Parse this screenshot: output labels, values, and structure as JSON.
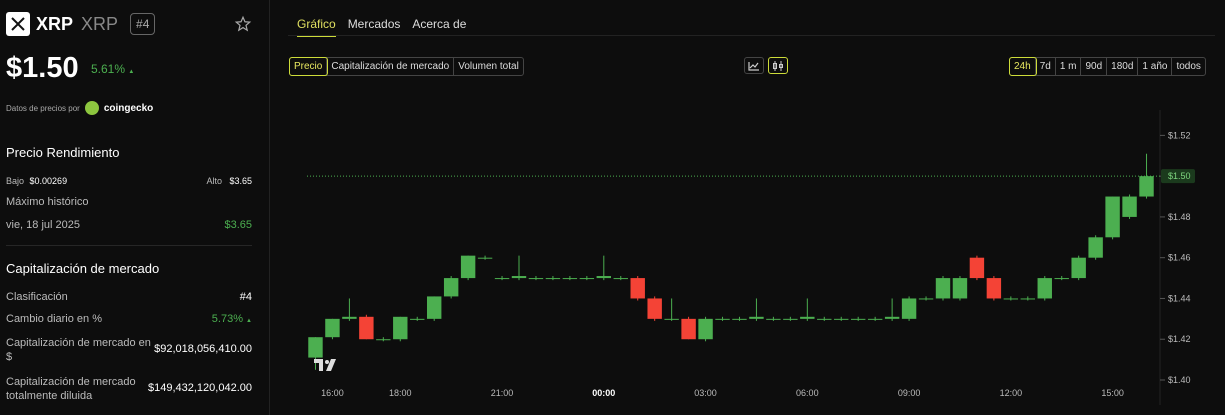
{
  "coin": {
    "symbol": "XRP",
    "name": "XRP",
    "rank": "#4",
    "price": "$1.50",
    "change": "5.61%",
    "change_arrow": "▲",
    "provider_prefix": "Datos de precios por",
    "provider": "coingecko"
  },
  "performance": {
    "title": "Precio Rendimiento",
    "low_label": "Bajo",
    "low_value": "$0.00269",
    "high_label": "Alto",
    "high_value": "$3.65",
    "ath_label": "Máximo histórico",
    "ath_date": "vie, 18 jul 2025",
    "ath_value": "$3.65"
  },
  "market": {
    "title": "Capitalización de mercado",
    "rank_label": "Clasificación",
    "rank_value": "#4",
    "daily_label": "Cambio diario en %",
    "daily_value": "5.73%",
    "daily_arrow": "▲",
    "cap_label": "Capitalización de mercado en $",
    "cap_value": "$92,018,056,410.00",
    "fdv_label": "Capitalización de mercado totalmente diluida",
    "fdv_value": "$149,432,120,042.00"
  },
  "tabs": [
    "Gráfico",
    "Mercados",
    "Acerca de"
  ],
  "metric_options": [
    "Precio",
    "Capitalización de mercado",
    "Volumen total"
  ],
  "chart_type_icons": [
    "line-chart-icon",
    "candlestick-icon"
  ],
  "ranges": [
    "24h",
    "7d",
    "1 m",
    "90d",
    "180d",
    "1 año",
    "todos"
  ],
  "colors": {
    "up": "#4caf50",
    "down": "#f44336",
    "accent": "#cddc39"
  },
  "chart_data": {
    "type": "candlestick",
    "x_tick_labels": [
      "16:00",
      "18:00",
      "21:00",
      "00:00",
      "03:00",
      "06:00",
      "09:00",
      "12:00",
      "15:00"
    ],
    "x_tick_index": [
      1,
      5,
      11,
      17,
      23,
      29,
      35,
      41,
      47
    ],
    "y_ticks": [
      1.4,
      1.42,
      1.44,
      1.46,
      1.48,
      1.5,
      1.52
    ],
    "y_tick_labels": [
      "$1.40",
      "$1.42",
      "$1.44",
      "$1.46",
      "$1.48",
      "$1.50",
      "$1.52"
    ],
    "ylim": [
      1.4,
      1.53
    ],
    "current_price": 1.5,
    "current_label": "$1.50",
    "candles": [
      {
        "o": 1.411,
        "h": 1.421,
        "l": 1.405,
        "c": 1.421
      },
      {
        "o": 1.421,
        "h": 1.43,
        "l": 1.42,
        "c": 1.43
      },
      {
        "o": 1.43,
        "h": 1.44,
        "l": 1.429,
        "c": 1.431
      },
      {
        "o": 1.431,
        "h": 1.432,
        "l": 1.42,
        "c": 1.42
      },
      {
        "o": 1.42,
        "h": 1.421,
        "l": 1.419,
        "c": 1.42
      },
      {
        "o": 1.42,
        "h": 1.431,
        "l": 1.419,
        "c": 1.431
      },
      {
        "o": 1.43,
        "h": 1.431,
        "l": 1.429,
        "c": 1.43
      },
      {
        "o": 1.43,
        "h": 1.441,
        "l": 1.429,
        "c": 1.441
      },
      {
        "o": 1.441,
        "h": 1.451,
        "l": 1.44,
        "c": 1.45
      },
      {
        "o": 1.45,
        "h": 1.461,
        "l": 1.449,
        "c": 1.461
      },
      {
        "o": 1.46,
        "h": 1.461,
        "l": 1.459,
        "c": 1.46
      },
      {
        "o": 1.45,
        "h": 1.451,
        "l": 1.449,
        "c": 1.45
      },
      {
        "o": 1.45,
        "h": 1.461,
        "l": 1.449,
        "c": 1.451
      },
      {
        "o": 1.45,
        "h": 1.451,
        "l": 1.449,
        "c": 1.45
      },
      {
        "o": 1.45,
        "h": 1.451,
        "l": 1.449,
        "c": 1.45
      },
      {
        "o": 1.45,
        "h": 1.451,
        "l": 1.449,
        "c": 1.45
      },
      {
        "o": 1.45,
        "h": 1.451,
        "l": 1.449,
        "c": 1.45
      },
      {
        "o": 1.45,
        "h": 1.461,
        "l": 1.449,
        "c": 1.451
      },
      {
        "o": 1.45,
        "h": 1.451,
        "l": 1.449,
        "c": 1.45
      },
      {
        "o": 1.45,
        "h": 1.451,
        "l": 1.439,
        "c": 1.44
      },
      {
        "o": 1.44,
        "h": 1.441,
        "l": 1.429,
        "c": 1.43
      },
      {
        "o": 1.43,
        "h": 1.44,
        "l": 1.429,
        "c": 1.43
      },
      {
        "o": 1.43,
        "h": 1.431,
        "l": 1.42,
        "c": 1.42
      },
      {
        "o": 1.42,
        "h": 1.431,
        "l": 1.419,
        "c": 1.43
      },
      {
        "o": 1.43,
        "h": 1.431,
        "l": 1.429,
        "c": 1.43
      },
      {
        "o": 1.43,
        "h": 1.431,
        "l": 1.429,
        "c": 1.43
      },
      {
        "o": 1.43,
        "h": 1.44,
        "l": 1.429,
        "c": 1.431
      },
      {
        "o": 1.43,
        "h": 1.431,
        "l": 1.429,
        "c": 1.43
      },
      {
        "o": 1.43,
        "h": 1.431,
        "l": 1.429,
        "c": 1.43
      },
      {
        "o": 1.43,
        "h": 1.44,
        "l": 1.429,
        "c": 1.431
      },
      {
        "o": 1.43,
        "h": 1.431,
        "l": 1.429,
        "c": 1.43
      },
      {
        "o": 1.43,
        "h": 1.431,
        "l": 1.429,
        "c": 1.43
      },
      {
        "o": 1.43,
        "h": 1.431,
        "l": 1.429,
        "c": 1.43
      },
      {
        "o": 1.43,
        "h": 1.431,
        "l": 1.429,
        "c": 1.43
      },
      {
        "o": 1.43,
        "h": 1.44,
        "l": 1.429,
        "c": 1.431
      },
      {
        "o": 1.43,
        "h": 1.441,
        "l": 1.429,
        "c": 1.44
      },
      {
        "o": 1.44,
        "h": 1.441,
        "l": 1.439,
        "c": 1.44
      },
      {
        "o": 1.44,
        "h": 1.451,
        "l": 1.439,
        "c": 1.45
      },
      {
        "o": 1.44,
        "h": 1.451,
        "l": 1.439,
        "c": 1.45
      },
      {
        "o": 1.46,
        "h": 1.461,
        "l": 1.449,
        "c": 1.45
      },
      {
        "o": 1.45,
        "h": 1.451,
        "l": 1.439,
        "c": 1.44
      },
      {
        "o": 1.44,
        "h": 1.441,
        "l": 1.439,
        "c": 1.44
      },
      {
        "o": 1.44,
        "h": 1.441,
        "l": 1.439,
        "c": 1.44
      },
      {
        "o": 1.44,
        "h": 1.451,
        "l": 1.439,
        "c": 1.45
      },
      {
        "o": 1.45,
        "h": 1.451,
        "l": 1.449,
        "c": 1.45
      },
      {
        "o": 1.45,
        "h": 1.461,
        "l": 1.449,
        "c": 1.46
      },
      {
        "o": 1.46,
        "h": 1.471,
        "l": 1.459,
        "c": 1.47
      },
      {
        "o": 1.47,
        "h": 1.49,
        "l": 1.469,
        "c": 1.49
      },
      {
        "o": 1.48,
        "h": 1.491,
        "l": 1.479,
        "c": 1.49
      },
      {
        "o": 1.49,
        "h": 1.511,
        "l": 1.489,
        "c": 1.5
      }
    ]
  }
}
